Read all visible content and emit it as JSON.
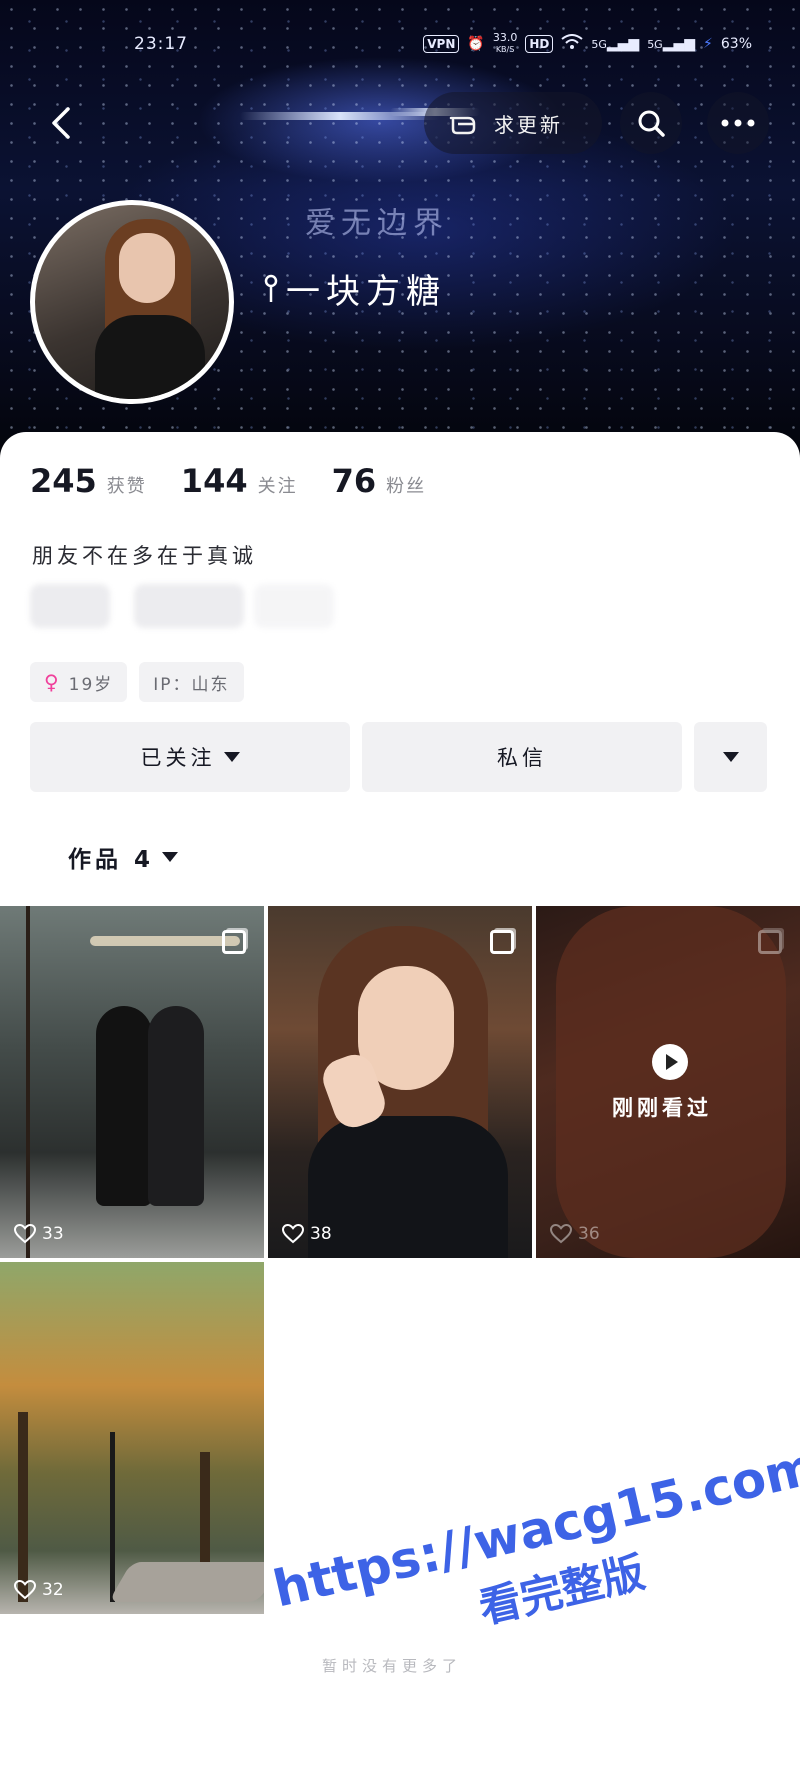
{
  "status_bar": {
    "time": "23:17",
    "vpn": "VPN",
    "speed_value": "33.0",
    "speed_unit": "KB/S",
    "hd": "HD",
    "signal_a": "5G",
    "signal_b": "5G",
    "battery": "63%"
  },
  "header": {
    "pill_label": "求更新",
    "banner_text": "爱无边界",
    "nickname": "一块方糖"
  },
  "stats": {
    "likes_count": "245",
    "likes_label": "获赞",
    "following_count": "144",
    "following_label": "关注",
    "followers_count": "76",
    "followers_label": "粉丝"
  },
  "bio": "朋友不在多在于真诚",
  "tags": {
    "age": "19岁",
    "ip": "IP：山东"
  },
  "actions": {
    "follow_label": "已关注",
    "message_label": "私信"
  },
  "works_tab": {
    "label": "作品 4"
  },
  "posts": [
    {
      "likes": "33"
    },
    {
      "likes": "38"
    },
    {
      "likes": "36",
      "overlay": "刚刚看过"
    },
    {
      "likes": "32"
    }
  ],
  "footer": {
    "no_more": "暂时没有更多了",
    "watermark_url": "https://wacg15.com",
    "watermark_sub": "看完整版"
  },
  "colors": {
    "gender": "#f0409b",
    "watermark": "#3d63e6",
    "button_bg": "#f1f1f3"
  }
}
